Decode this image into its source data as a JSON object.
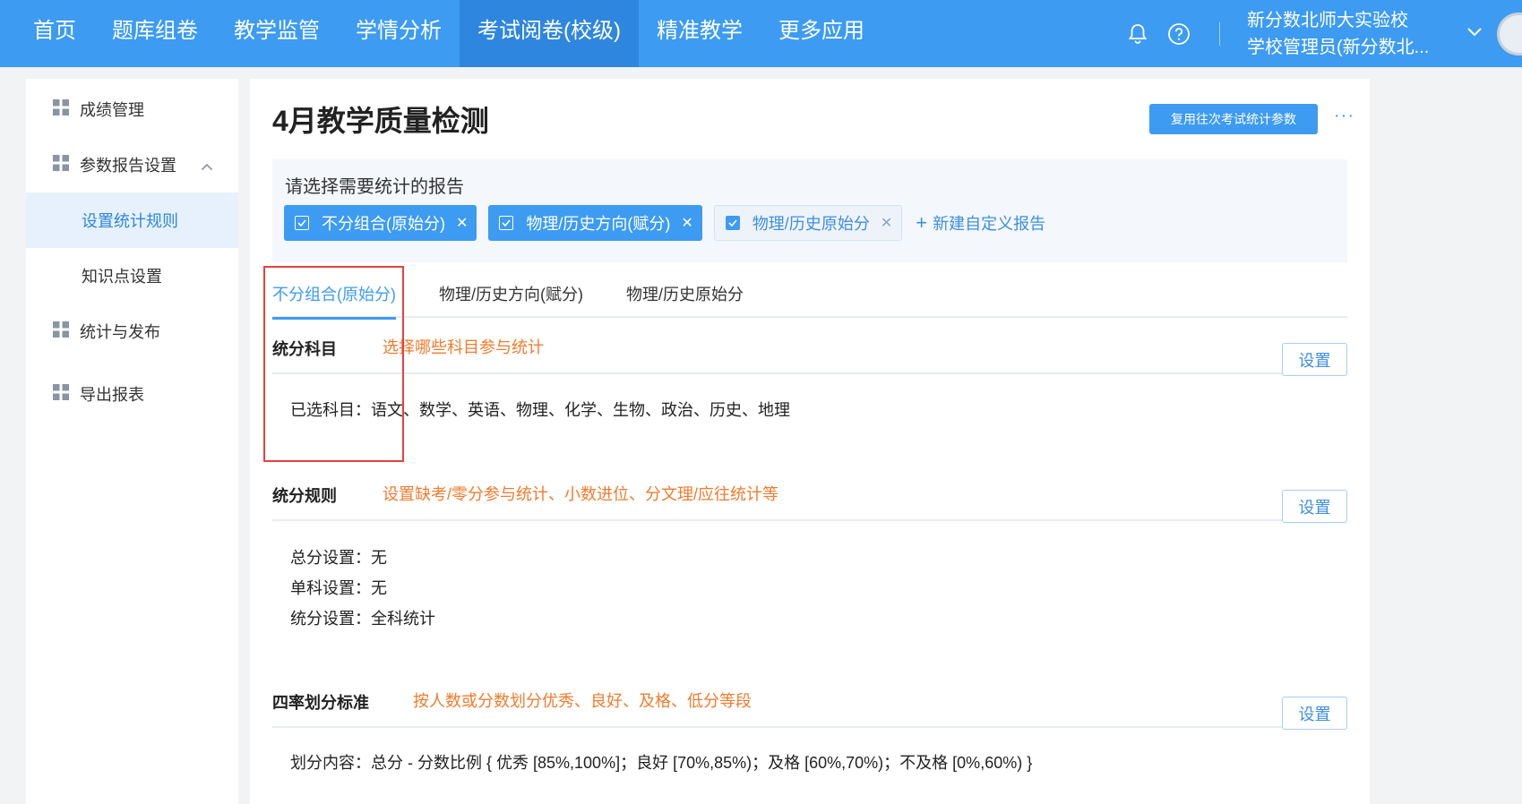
{
  "nav": {
    "items": [
      "首页",
      "题库组卷",
      "教学监管",
      "学情分析",
      "考试阅卷(校级)",
      "精准教学",
      "更多应用"
    ],
    "active_index": 4
  },
  "user": {
    "school": "新分数北师大实验校",
    "role": "学校管理员(新分数北..."
  },
  "icons": {
    "notification": "bell-icon",
    "help": "question-circle-icon",
    "dropdown": "chevron-down-icon",
    "sidebar_group": "grid-icon",
    "collapse": "chevron-up-icon",
    "checkbox": "checkbox-checked-icon",
    "close": "close-icon",
    "add": "plus-icon"
  },
  "sidebar": {
    "items": [
      {
        "label": "成绩管理"
      },
      {
        "label": "参数报告设置"
      },
      {
        "label": "设置统计规则"
      },
      {
        "label": "知识点设置"
      },
      {
        "label": "统计与发布"
      },
      {
        "label": "导出报表"
      }
    ]
  },
  "main": {
    "title": "4月教学质量检测",
    "reuse_button": "复用往次考试统计参数",
    "more_button": "···",
    "report_prompt": "请选择需要统计的报告",
    "reports": [
      {
        "label": "不分组合(原始分)",
        "selected": true
      },
      {
        "label": "物理/历史方向(赋分)",
        "selected": true
      },
      {
        "label": "物理/历史原始分",
        "selected": false
      }
    ],
    "new_report": "新建自定义报告",
    "tabs": [
      "不分组合(原始分)",
      "物理/历史方向(赋分)",
      "物理/历史原始分"
    ],
    "sections": [
      {
        "title": "统分科目",
        "hint": "选择哪些科目参与统计",
        "button": "设置",
        "lines": [
          "已选科目：语文、数学、英语、物理、化学、生物、政治、历史、地理"
        ]
      },
      {
        "title": "统分规则",
        "hint": "设置缺考/零分参与统计、小数进位、分文理/应往统计等",
        "button": "设置",
        "lines": [
          "总分设置：无",
          "单科设置：无",
          "统分设置：全科统计"
        ]
      },
      {
        "title": "四率划分标准",
        "hint": "按人数或分数划分优秀、良好、及格、低分等段",
        "button": "设置",
        "lines": [
          "划分内容：总分 - 分数比例   { 优秀 [85%,100%]；良好 [70%,85%)；及格 [60%,70%)；不及格 [0%,60%) }"
        ]
      }
    ]
  },
  "colors": {
    "primary": "#3d9bf2",
    "nav_active": "#2f86df",
    "hint_orange": "#f07b2e",
    "highlight_red": "#e84040"
  }
}
